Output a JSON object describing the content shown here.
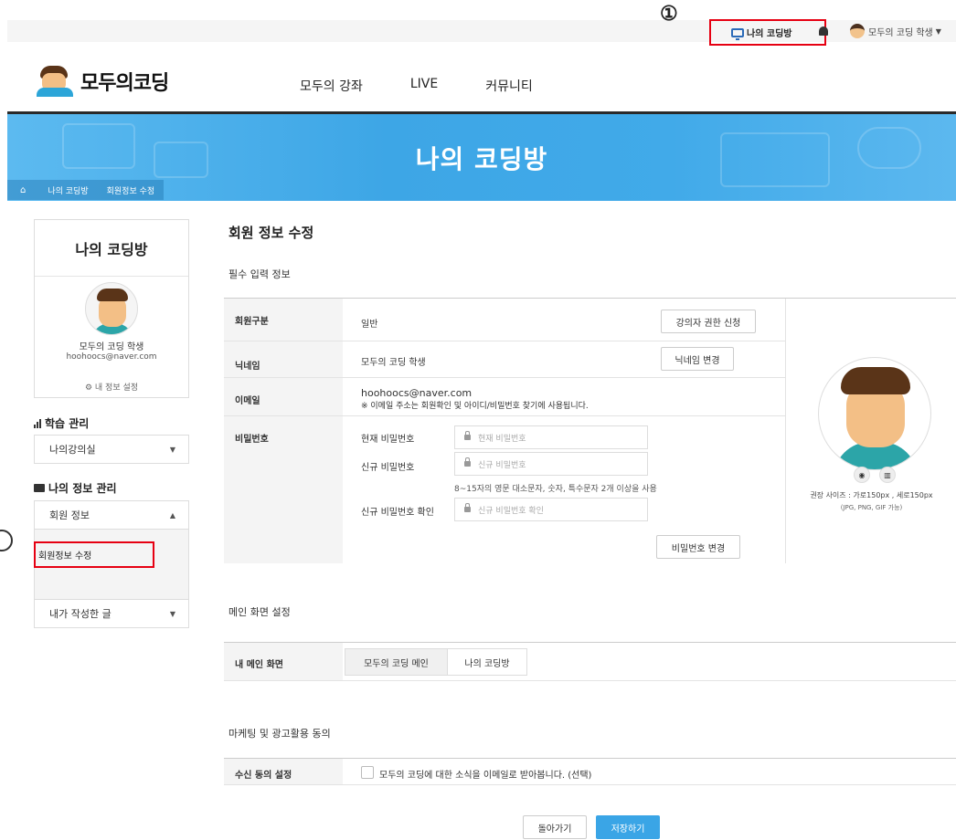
{
  "annotations": {
    "marker_1": "①"
  },
  "topbar": {
    "my_coding_room": "나의 코딩방",
    "user_name": "모두의 코딩 학생"
  },
  "header": {
    "logo_text": "모두의코딩",
    "nav": [
      "모두의 강좌",
      "LIVE",
      "커뮤니티"
    ]
  },
  "banner": {
    "title": "나의 코딩방",
    "breadcrumb": [
      "나의 코딩방",
      "회원정보 수정"
    ]
  },
  "sidebar": {
    "title": "나의 코딩방",
    "profile_name": "모두의 코딩 학생",
    "profile_email": "hoohoocs@naver.com",
    "settings_link": "내 정보 설정",
    "learning_title": "학습 관리",
    "learning_select": "나의강의실",
    "info_title": "나의 정보 관리",
    "member_info": "회원 정보",
    "member_edit": "회원정보 수정",
    "my_posts": "내가 작성한 글"
  },
  "main": {
    "page_title": "회원 정보 수정",
    "required_title": "필수 입력 정보",
    "member_type_label": "회원구분",
    "member_type_value": "일반",
    "instructor_button": "강의자 권한 신청",
    "nickname_label": "닉네임",
    "nickname_value": "모두의 코딩 학생",
    "nickname_button": "닉네임 변경",
    "email_label": "이메일",
    "email_value": "hoohoocs@naver.com",
    "email_note": "※ 이메일 주소는 회원확인 및 아이디/비밀번호 찾기에 사용됩니다.",
    "password_label": "비밀번호",
    "current_pw_label": "현재 비밀번호",
    "current_pw_placeholder": "현재 비밀번호",
    "new_pw_label": "신규 비밀번호",
    "new_pw_placeholder": "신규 비밀번호",
    "pw_rule": "8~15자의 영문 대소문자, 숫자, 특수문자 2개 이상을 사용",
    "confirm_pw_label": "신규 비밀번호 확인",
    "confirm_pw_placeholder": "신규 비밀번호 확인",
    "change_pw_button": "비밀번호 변경",
    "photo_size_note": "권장 사이즈 : 가로150px , 세로150px",
    "photo_format_note": "(JPG, PNG, GIF 가능)",
    "main_screen_title": "메인 화면 설정",
    "main_screen_label": "내 메인 화면",
    "main_option_1": "모두의 코딩 메인",
    "main_option_2": "나의 코딩방",
    "marketing_title": "마케팅 및 광고활용 동의",
    "consent_label": "수신 동의 설정",
    "consent_text": "모두의 코딩에 대한 소식을 이메일로 받아봅니다. (선택)",
    "back_button": "돌아가기",
    "save_button": "저장하기"
  },
  "colors": {
    "accent": "#3aa5e6",
    "highlight": "#e60012"
  }
}
